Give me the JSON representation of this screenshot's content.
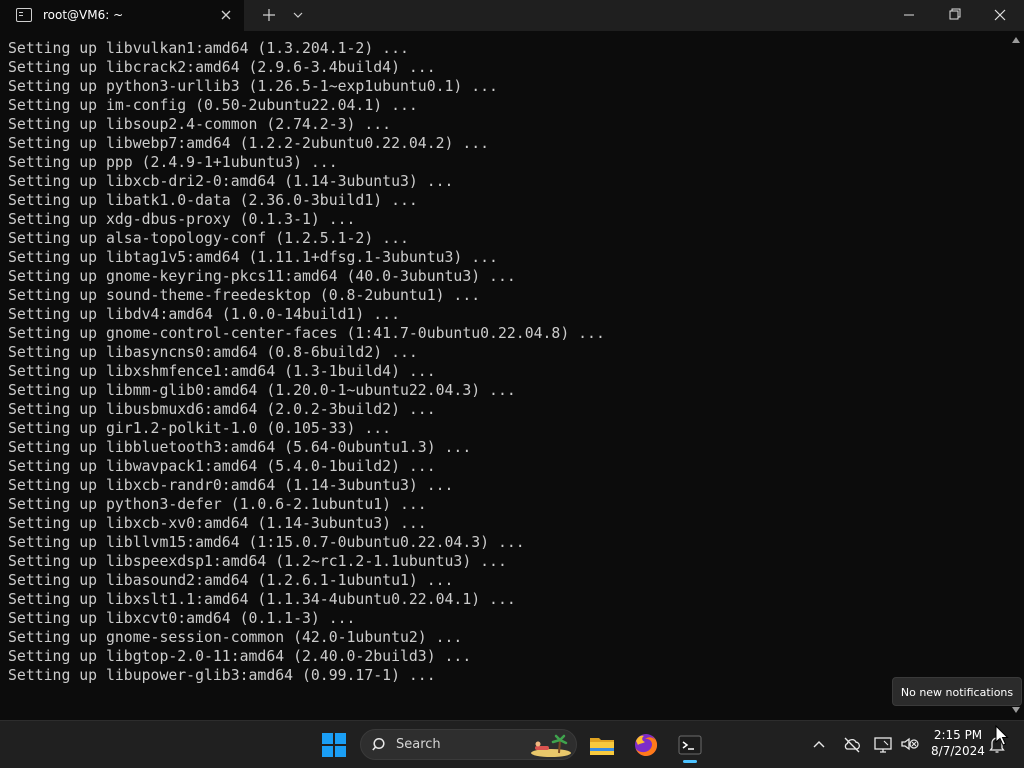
{
  "window": {
    "tab_title": "root@VM6: ~"
  },
  "terminal": {
    "lines": [
      "Setting up libvulkan1:amd64 (1.3.204.1-2) ...",
      "Setting up libcrack2:amd64 (2.9.6-3.4build4) ...",
      "Setting up python3-urllib3 (1.26.5-1~exp1ubuntu0.1) ...",
      "Setting up im-config (0.50-2ubuntu22.04.1) ...",
      "Setting up libsoup2.4-common (2.74.2-3) ...",
      "Setting up libwebp7:amd64 (1.2.2-2ubuntu0.22.04.2) ...",
      "Setting up ppp (2.4.9-1+1ubuntu3) ...",
      "Setting up libxcb-dri2-0:amd64 (1.14-3ubuntu3) ...",
      "Setting up libatk1.0-data (2.36.0-3build1) ...",
      "Setting up xdg-dbus-proxy (0.1.3-1) ...",
      "Setting up alsa-topology-conf (1.2.5.1-2) ...",
      "Setting up libtag1v5:amd64 (1.11.1+dfsg.1-3ubuntu3) ...",
      "Setting up gnome-keyring-pkcs11:amd64 (40.0-3ubuntu3) ...",
      "Setting up sound-theme-freedesktop (0.8-2ubuntu1) ...",
      "Setting up libdv4:amd64 (1.0.0-14build1) ...",
      "Setting up gnome-control-center-faces (1:41.7-0ubuntu0.22.04.8) ...",
      "Setting up libasyncns0:amd64 (0.8-6build2) ...",
      "Setting up libxshmfence1:amd64 (1.3-1build4) ...",
      "Setting up libmm-glib0:amd64 (1.20.0-1~ubuntu22.04.3) ...",
      "Setting up libusbmuxd6:amd64 (2.0.2-3build2) ...",
      "Setting up gir1.2-polkit-1.0 (0.105-33) ...",
      "Setting up libbluetooth3:amd64 (5.64-0ubuntu1.3) ...",
      "Setting up libwavpack1:amd64 (5.4.0-1build2) ...",
      "Setting up libxcb-randr0:amd64 (1.14-3ubuntu3) ...",
      "Setting up python3-defer (1.0.6-2.1ubuntu1) ...",
      "Setting up libxcb-xv0:amd64 (1.14-3ubuntu3) ...",
      "Setting up libllvm15:amd64 (1:15.0.7-0ubuntu0.22.04.3) ...",
      "Setting up libspeexdsp1:amd64 (1.2~rc1.2-1.1ubuntu3) ...",
      "Setting up libasound2:amd64 (1.2.6.1-1ubuntu1) ...",
      "Setting up libxslt1.1:amd64 (1.1.34-4ubuntu0.22.04.1) ...",
      "Setting up libxcvt0:amd64 (0.1.1-3) ...",
      "Setting up gnome-session-common (42.0-1ubuntu2) ...",
      "Setting up libgtop-2.0-11:amd64 (2.40.0-2build3) ...",
      "Setting up libupower-glib3:amd64 (0.99.17-1) ..."
    ]
  },
  "notification": {
    "text": "No new notifications"
  },
  "taskbar": {
    "search_label": "Search",
    "time": "2:15 PM",
    "date": "8/7/2024"
  },
  "colors": {
    "terminal_bg": "#0c0c0c",
    "terminal_text": "#cccccc",
    "taskbar_bg": "#202020",
    "accent": "#4cc2ff",
    "windows_logo": "#1a9ef5"
  },
  "icons": {
    "tab": "terminal-icon",
    "start": "windows-logo-icon",
    "search": "search-icon",
    "explorer": "folder-icon",
    "browser": "firefox-icon",
    "terminal_app": "terminal-icon",
    "tray": [
      "chevron-up-icon",
      "cloud-off-icon",
      "display-icon",
      "speaker-muted-icon"
    ],
    "notifications": "bell-icon"
  }
}
